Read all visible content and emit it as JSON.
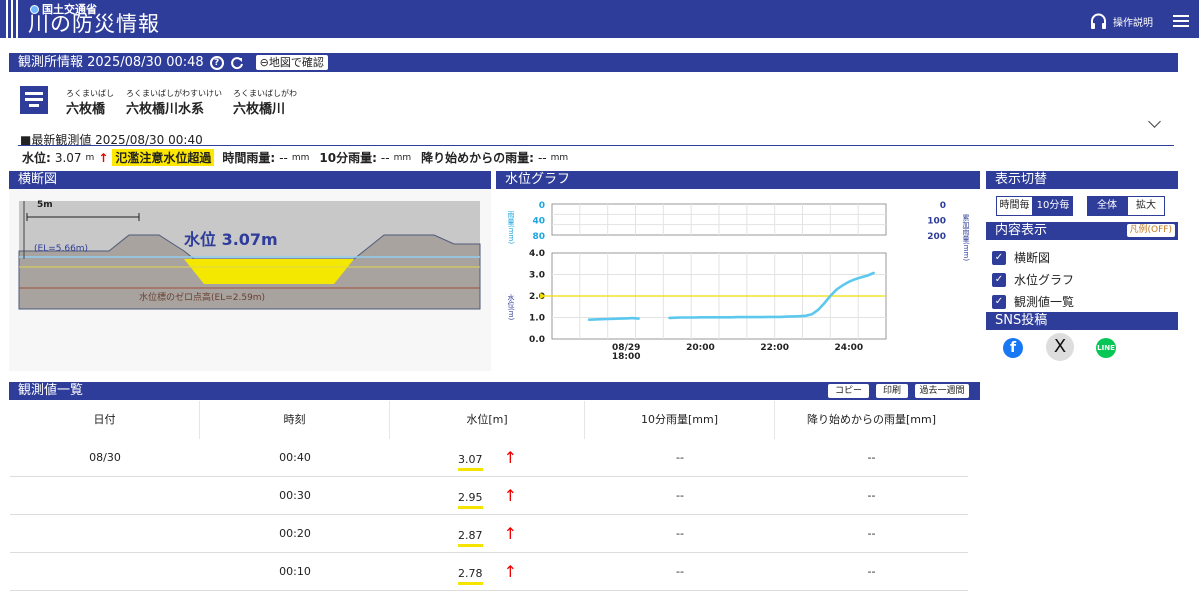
{
  "header": {
    "ministry": "国土交通省",
    "site_title": "川の防災情報",
    "help_label": "操作説明"
  },
  "station": {
    "section_title": "観測所情報 2025/08/30 00:48",
    "map_button": "地図で確認",
    "name_ruby": "ろくまいばし",
    "name": "六枚橋",
    "system_ruby": "ろくまいばしがわすいけい",
    "system": "六枚橋川水系",
    "river_ruby": "ろくまいばしがわ",
    "river": "六枚橋川",
    "latest_label": "■最新観測値 2025/08/30 00:40",
    "level_label": "水位:",
    "level_value": "3.07",
    "level_unit": "m",
    "warning": "氾濫注意水位超過",
    "hourly_label": "時間雨量:",
    "hourly_value": "--",
    "rain_unit": "mm",
    "tenmin_label": "10分雨量:",
    "tenmin_value": "--",
    "cumulative_label": "降り始めからの雨量:",
    "cumulative_value": "--"
  },
  "cross_section": {
    "title": "横断図",
    "scale_label": "5m",
    "el_label": "(EL=5.66m)",
    "level_text": "水位 3.07m",
    "zero_label": "水位標のゼロ点高(EL=2.59m)"
  },
  "graph": {
    "title": "水位グラフ",
    "rain_axis_label": "雨量(mm)",
    "cum_axis_label": "累加雨量(mm)",
    "level_axis_label": "水位(m)"
  },
  "chart_data": {
    "type": "line",
    "title": "水位グラフ",
    "x": [
      "17:00",
      "17:10",
      "17:20",
      "17:30",
      "17:40",
      "17:50",
      "18:00",
      "18:10",
      "18:20",
      "19:10",
      "19:20",
      "19:30",
      "19:40",
      "19:50",
      "20:00",
      "20:10",
      "20:20",
      "20:30",
      "20:40",
      "20:50",
      "21:00",
      "21:10",
      "21:20",
      "21:30",
      "21:40",
      "21:50",
      "22:00",
      "22:10",
      "22:20",
      "22:30",
      "22:40",
      "22:50",
      "23:00",
      "23:10",
      "23:20",
      "23:30",
      "23:40",
      "23:50",
      "00:00",
      "00:10",
      "00:20",
      "00:30",
      "00:40"
    ],
    "series": [
      {
        "values": [
          0.9,
          0.91,
          0.92,
          0.93,
          0.94,
          0.95,
          0.96,
          0.97,
          0.95,
          0.98,
          0.99,
          1.0,
          1.0,
          1.0,
          1.01,
          1.01,
          1.01,
          1.01,
          1.01,
          1.01,
          1.02,
          1.02,
          1.02,
          1.02,
          1.02,
          1.03,
          1.03,
          1.03,
          1.04,
          1.05,
          1.06,
          1.08,
          1.15,
          1.35,
          1.65,
          2.0,
          2.3,
          2.5,
          2.66,
          2.78,
          2.87,
          2.95,
          3.07
        ]
      }
    ],
    "threshold": 2.0,
    "y_ticks": [
      "4.0",
      "3.0",
      "2.0",
      "1.0",
      "0.0"
    ],
    "ylim": [
      0,
      4
    ],
    "x_tick_labels": [
      "08/29\n18:00",
      "20:00",
      "22:00",
      "24:00"
    ],
    "rain_ticks_left": [
      "0",
      "40",
      "80"
    ],
    "rain_ticks_right": [
      "0",
      "100",
      "200"
    ],
    "grid": true
  },
  "controls": {
    "title": "表示切替",
    "per_hour": "時間毎",
    "per_10min": "10分毎",
    "all": "全体",
    "zoom": "拡大",
    "content_title": "内容表示",
    "legend_btn": "凡例(OFF)",
    "items": [
      "横断図",
      "水位グラフ",
      "観測値一覧"
    ],
    "sns_title": "SNS投稿"
  },
  "table": {
    "title": "観測値一覧",
    "copy": "コピー",
    "print": "印刷",
    "past": "過去一週間",
    "headers": [
      "日付",
      "時刻",
      "水位[m]",
      "10分雨量[mm]",
      "降り始めからの雨量[mm]"
    ],
    "rows": [
      {
        "date": "08/30",
        "time": "00:40",
        "level": "3.07",
        "rain10": "--",
        "cum": "--"
      },
      {
        "date": "",
        "time": "00:30",
        "level": "2.95",
        "rain10": "--",
        "cum": "--"
      },
      {
        "date": "",
        "time": "00:20",
        "level": "2.87",
        "rain10": "--",
        "cum": "--"
      },
      {
        "date": "",
        "time": "00:10",
        "level": "2.78",
        "rain10": "--",
        "cum": "--"
      }
    ]
  }
}
